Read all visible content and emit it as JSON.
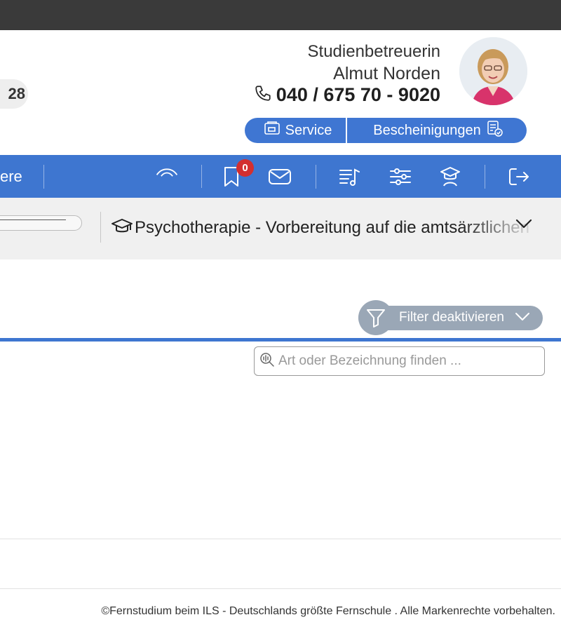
{
  "header": {
    "partial_counter": "28",
    "advisor": {
      "role": "Studienbetreuerin",
      "name": "Almut Norden",
      "phone": "040 / 675 70 - 9020"
    },
    "service_label": "Service",
    "certificates_label": "Bescheinigungen"
  },
  "nav": {
    "partial_label": "ere",
    "bookmark_badge": "0",
    "icons": [
      "signal-icon",
      "bookmark-icon",
      "mail-icon",
      "playlist-icon",
      "settings-sliders-icon",
      "graduate-icon",
      "logout-icon"
    ]
  },
  "course": {
    "selected": "Psychotherapie - Vorbereitung auf die amtsärztlichen"
  },
  "filter": {
    "label": "Filter deaktivieren"
  },
  "search": {
    "placeholder": "Art oder Bezeichnung finden ..."
  },
  "footer": {
    "text": "©Fernstudium beim ILS - Deutschlands größte Fernschule . Alle Markenrechte vorbehalten."
  },
  "colors": {
    "primary": "#3e76d0",
    "topbar": "#3a3a3a",
    "filter": "#9aa7b6",
    "badge": "#d32f2f"
  }
}
